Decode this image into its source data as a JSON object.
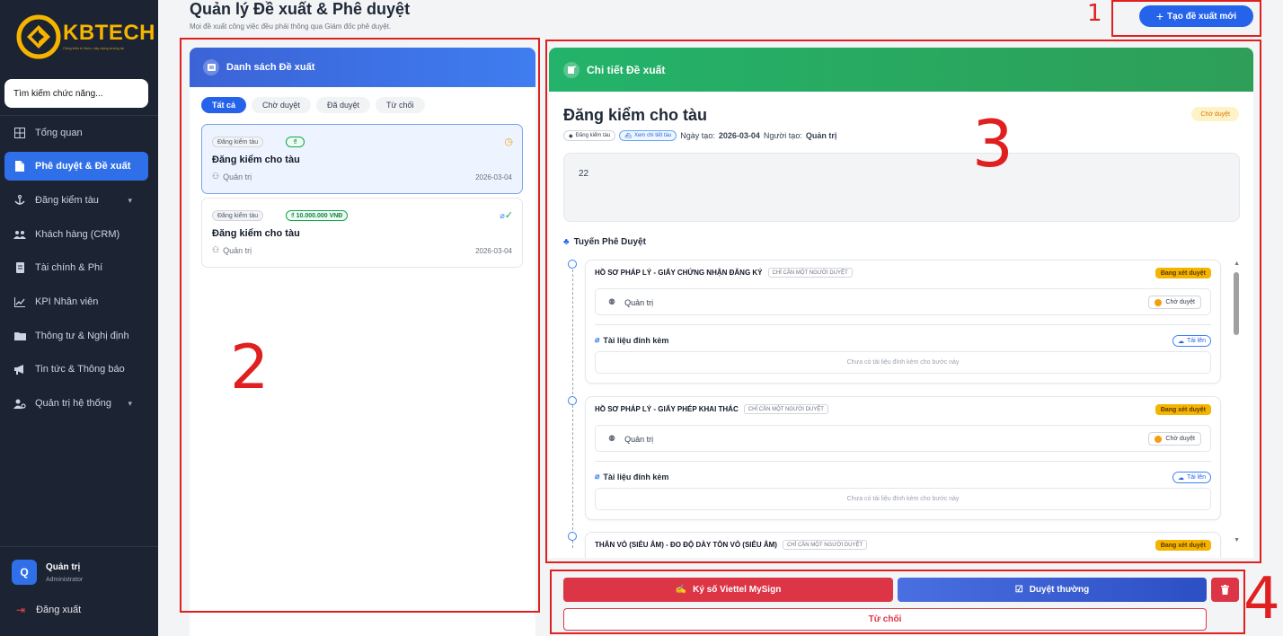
{
  "sidebar": {
    "logo_name": "KBTECH",
    "logo_tagline": "Cũng kiến trí thức, xây dựng tương lai",
    "search_placeholder": "Tìm kiếm chức năng...",
    "items": [
      {
        "label": "Tổng quan",
        "icon": "grid-icon"
      },
      {
        "label": "Phê duyệt & Đề xuất",
        "icon": "document-icon",
        "active": true
      },
      {
        "label": "Đăng kiểm tàu",
        "icon": "anchor-icon",
        "expandable": true
      },
      {
        "label": "Khách hàng (CRM)",
        "icon": "users-icon"
      },
      {
        "label": "Tài chính & Phí",
        "icon": "invoice-icon"
      },
      {
        "label": "KPI Nhân viên",
        "icon": "chart-line-icon"
      },
      {
        "label": "Thông tư & Nghị định",
        "icon": "folder-icon"
      },
      {
        "label": "Tin tức & Thông báo",
        "icon": "megaphone-icon"
      },
      {
        "label": "Quản trị hệ thống",
        "icon": "user-gear-icon",
        "expandable": true
      }
    ],
    "user": {
      "initial": "Q",
      "name": "Quản trị",
      "role": "Administrator"
    },
    "logout_label": "Đăng xuất"
  },
  "header": {
    "title": "Quản lý Đề xuất & Phê duyệt",
    "subtitle": "Mọi đề xuất công việc đều phải thông qua Giám đốc phê duyệt.",
    "create_label": "Tạo đề xuất mới"
  },
  "list": {
    "title": "Danh sách Đề xuất",
    "filters": [
      "Tất cả",
      "Chờ duyệt",
      "Đã duyệt",
      "Từ chối"
    ],
    "active_filter": "Tất cả",
    "items": [
      {
        "tag": "Đăng kiểm tàu",
        "amount": "",
        "title": "Đăng kiểm cho tàu",
        "user": "Quản trị",
        "date": "2026-03-04",
        "status": "pending",
        "selected": true
      },
      {
        "tag": "Đăng kiểm tàu",
        "amount": "10.000.000 VNĐ",
        "title": "Đăng kiểm cho tàu",
        "user": "Quản trị",
        "date": "2026-03-04",
        "status": "approved",
        "selected": false
      }
    ]
  },
  "detail": {
    "header": "Chi tiết Đề xuất",
    "title": "Đăng kiểm cho tàu",
    "status": "Chờ duyệt",
    "tag": "Đăng kiểm tàu",
    "view_ship_label": "Xem chi tiết tàu",
    "created_label": "Ngày tạo:",
    "created_date": "2026-03-04",
    "creator_label": "Người tạo:",
    "creator": "Quản trị",
    "content": "22",
    "route_title": "Tuyến Phê Duyệt",
    "steps": [
      {
        "title": "HỒ SƠ PHÁP LÝ - GIẤY CHỨNG NHẬN ĐĂNG KÝ",
        "note": "CHỈ CẦN MỘT NGƯỜI DUYỆT",
        "status": "Đang xét duyệt",
        "approver": "Quản trị",
        "approver_status": "Chờ duyệt",
        "attachments_label": "Tài liệu đính kèm",
        "upload_label": "Tải lên",
        "empty_text": "Chưa có tài liệu đính kèm cho bước này"
      },
      {
        "title": "HỒ SƠ PHÁP LÝ - GIẤY PHÉP KHAI THÁC",
        "note": "CHỈ CẦN MỘT NGƯỜI DUYỆT",
        "status": "Đang xét duyệt",
        "approver": "Quản trị",
        "approver_status": "Chờ duyệt",
        "attachments_label": "Tài liệu đính kèm",
        "upload_label": "Tải lên",
        "empty_text": "Chưa có tài liệu đính kèm cho bước này"
      },
      {
        "title": "THÂN VỎ (SIÊU ÂM) - ĐO ĐỘ DÀY TÔN VỎ (SIÊU ÂM)",
        "note": "CHỈ CẦN MỘT NGƯỜI DUYỆT",
        "status": "Đang xét duyệt"
      }
    ]
  },
  "actions": {
    "sign_label": "Ký số Viettel MySign",
    "approve_label": "Duyệt thường",
    "reject_label": "Từ chối"
  },
  "annotations": [
    "1",
    "2",
    "3",
    "4"
  ],
  "colors": {
    "sidebar_bg": "#1c2332",
    "accent_blue": "#2563eb",
    "accent_green": "#23b36a",
    "danger_red": "#dc3545",
    "pending_yellow": "#f5b400",
    "annotation_red": "#e02020"
  }
}
